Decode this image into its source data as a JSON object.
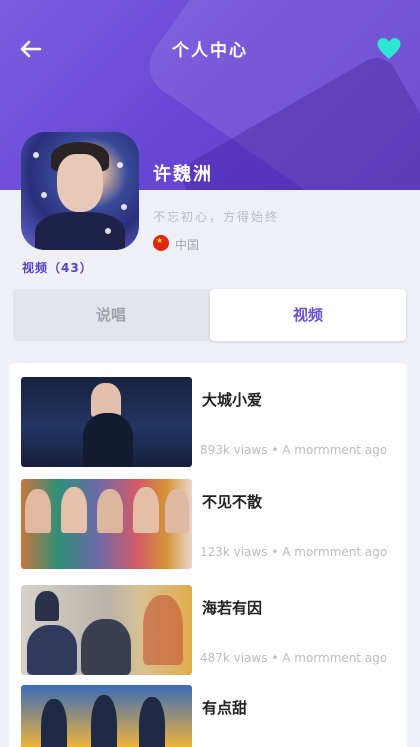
{
  "header": {
    "title": "个人中心",
    "back_icon": "back-arrow-icon",
    "favorite_icon": "heart-icon",
    "accent_color": "#6a48d6",
    "heart_color": "#2ee5d3"
  },
  "profile": {
    "name": "许魏洲",
    "motto": "不忘初心，方得始终",
    "country": "中国",
    "flag_icon": "china-flag-icon",
    "video_count_label": "视频（43）"
  },
  "tabs": [
    {
      "label": "说唱",
      "active": false
    },
    {
      "label": "视频",
      "active": true
    }
  ],
  "videos": [
    {
      "title": "大城小爱",
      "meta": "893k viaws • A mormment ago"
    },
    {
      "title": "不见不散",
      "meta": "123k viaws • A mormment ago"
    },
    {
      "title": "海若有因",
      "meta": "487k viaws • A mormment ago"
    },
    {
      "title": "有点甜",
      "meta": ""
    }
  ]
}
